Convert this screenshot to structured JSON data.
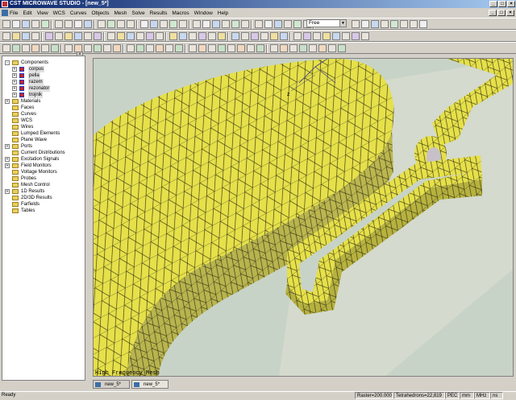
{
  "window": {
    "title": "CST MICROWAVE STUDIO - [new_5*]"
  },
  "menubar": {
    "items": [
      "File",
      "Edit",
      "View",
      "WCS",
      "Curves",
      "Objects",
      "Mesh",
      "Solve",
      "Results",
      "Macros",
      "Window",
      "Help"
    ]
  },
  "toolbar": {
    "combo_value": "Free"
  },
  "tree": {
    "items": [
      {
        "label": "Components",
        "level": 0,
        "type": "folder",
        "expander": "-"
      },
      {
        "label": "corpus",
        "level": 1,
        "type": "cube",
        "expander": "+"
      },
      {
        "label": "pella",
        "level": 1,
        "type": "cube",
        "expander": "+"
      },
      {
        "label": "razem",
        "level": 1,
        "type": "cube",
        "expander": "+"
      },
      {
        "label": "rezonator",
        "level": 1,
        "type": "cube",
        "expander": "+"
      },
      {
        "label": "trojnik",
        "level": 1,
        "type": "cube",
        "expander": "+"
      },
      {
        "label": "Materials",
        "level": 0,
        "type": "folder",
        "expander": "+"
      },
      {
        "label": "Faces",
        "level": 0,
        "type": "folder",
        "expander": ""
      },
      {
        "label": "Curves",
        "level": 0,
        "type": "folder",
        "expander": ""
      },
      {
        "label": "WCS",
        "level": 0,
        "type": "folder",
        "expander": ""
      },
      {
        "label": "Wires",
        "level": 0,
        "type": "folder",
        "expander": ""
      },
      {
        "label": "Lumped Elements",
        "level": 0,
        "type": "folder",
        "expander": ""
      },
      {
        "label": "Plane Wave",
        "level": 0,
        "type": "folder",
        "expander": ""
      },
      {
        "label": "Ports",
        "level": 0,
        "type": "folder",
        "expander": "+"
      },
      {
        "label": "Current Distributions",
        "level": 0,
        "type": "folder",
        "expander": ""
      },
      {
        "label": "Excitation Signals",
        "level": 0,
        "type": "folder",
        "expander": "+"
      },
      {
        "label": "Field Monitors",
        "level": 0,
        "type": "folder",
        "expander": "+"
      },
      {
        "label": "Voltage Monitors",
        "level": 0,
        "type": "folder",
        "expander": ""
      },
      {
        "label": "Probes",
        "level": 0,
        "type": "folder",
        "expander": ""
      },
      {
        "label": "Mesh Control",
        "level": 0,
        "type": "folder",
        "expander": ""
      },
      {
        "label": "1D Results",
        "level": 0,
        "type": "folder",
        "expander": "+"
      },
      {
        "label": "2D/3D Results",
        "level": 0,
        "type": "folder",
        "expander": ""
      },
      {
        "label": "Farfields",
        "level": 0,
        "type": "folder",
        "expander": ""
      },
      {
        "label": "Tables",
        "level": 0,
        "type": "folder",
        "expander": ""
      }
    ]
  },
  "viewport": {
    "label": "High Frequency Mesh",
    "axis_label": "z"
  },
  "tabs": [
    {
      "label": "new_5*"
    },
    {
      "label": "new_5*"
    }
  ],
  "status": {
    "ready": "Ready",
    "raster": "Raster=200.000",
    "tetra": "Tetrahedrons=22,819",
    "pec": "PEC",
    "mm": "mm",
    "mhz": "MHz",
    "ns": "ns"
  },
  "colors": {
    "mesh_fill": "#e6e04a",
    "mesh_line": "#2a2a10",
    "background": "#c8d3c7",
    "titlebar": "#0a246a"
  }
}
